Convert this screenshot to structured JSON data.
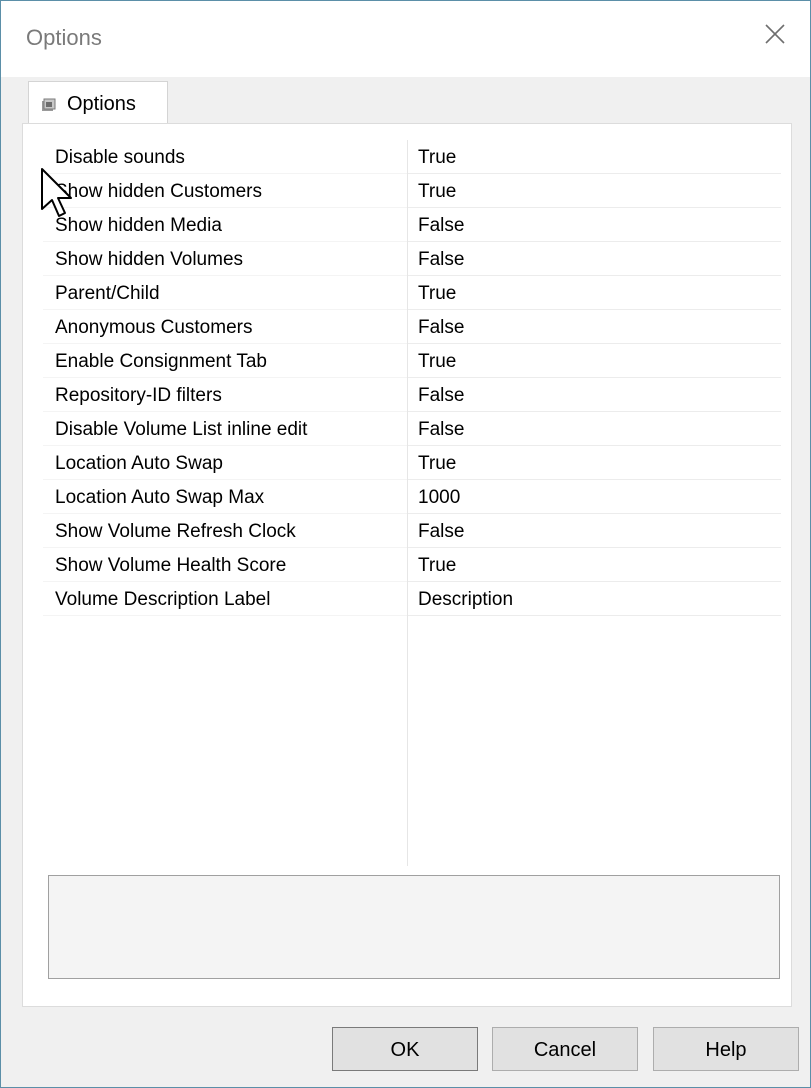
{
  "window": {
    "title": "Options"
  },
  "tab": {
    "label": "Options",
    "icon": "options-tab-icon"
  },
  "properties": [
    {
      "name": "Disable sounds",
      "value": "True"
    },
    {
      "name": "Show hidden Customers",
      "value": "True"
    },
    {
      "name": "Show hidden Media",
      "value": "False"
    },
    {
      "name": "Show hidden Volumes",
      "value": "False"
    },
    {
      "name": "Parent/Child",
      "value": "True"
    },
    {
      "name": "Anonymous Customers",
      "value": "False"
    },
    {
      "name": "Enable Consignment Tab",
      "value": "True"
    },
    {
      "name": "Repository-ID filters",
      "value": "False"
    },
    {
      "name": "Disable Volume List inline edit",
      "value": "False"
    },
    {
      "name": "Location Auto Swap",
      "value": "True"
    },
    {
      "name": "Location Auto Swap Max",
      "value": "1000"
    },
    {
      "name": "Show Volume Refresh Clock",
      "value": "False"
    },
    {
      "name": "Show Volume Health Score",
      "value": "True"
    },
    {
      "name": "Volume Description Label",
      "value": "Description"
    }
  ],
  "buttons": {
    "ok": "OK",
    "cancel": "Cancel",
    "help": "Help"
  },
  "colors": {
    "window_border": "#5b8fa8",
    "dialog_background": "#f0f0f0",
    "button_face": "#e1e1e1"
  }
}
